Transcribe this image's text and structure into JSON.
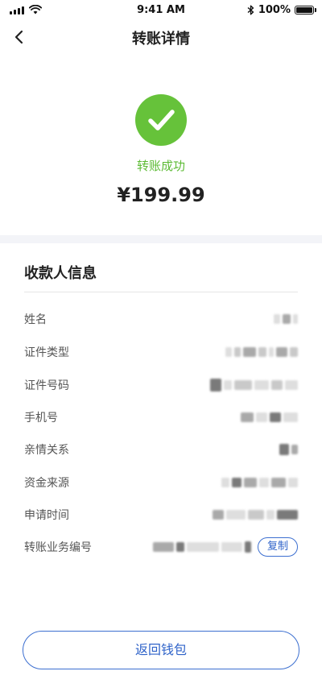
{
  "status_bar": {
    "time": "9:41 AM",
    "battery": "100%",
    "battery_level": 1.0
  },
  "nav": {
    "title": "转账详情",
    "back_icon": "chevron-left-icon"
  },
  "result": {
    "status_icon": "check-circle-icon",
    "status_text": "转账成功",
    "amount": "¥199.99",
    "accent_color": "#66c23a"
  },
  "payee": {
    "title": "收款人信息",
    "rows": [
      {
        "label": "姓名"
      },
      {
        "label": "证件类型"
      },
      {
        "label": "证件号码"
      },
      {
        "label": "手机号"
      },
      {
        "label": "亲情关系"
      },
      {
        "label": "资金来源"
      },
      {
        "label": "申请时间"
      },
      {
        "label": "转账业务编号"
      }
    ],
    "copy_label": "复制"
  },
  "footer": {
    "return_label": "返回钱包",
    "button_color": "#3c6fd0"
  }
}
